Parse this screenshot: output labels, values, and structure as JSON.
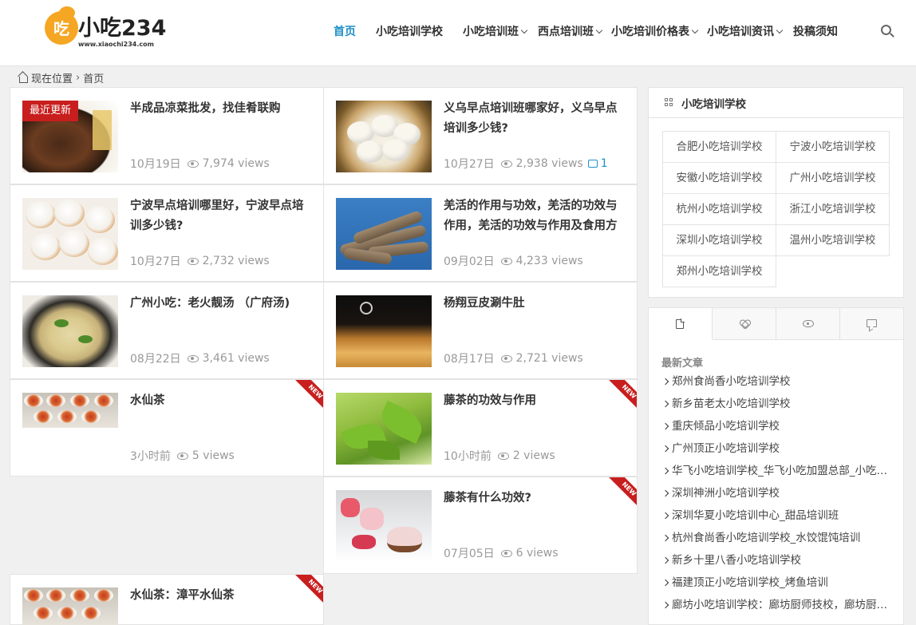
{
  "brand": {
    "name": "小吃234",
    "logo_char": "吃",
    "url_text": "www.xiaochi234.com"
  },
  "nav": {
    "items": [
      {
        "label": "首页",
        "active": true,
        "dropdown": false
      },
      {
        "label": "小吃培训学校",
        "active": false,
        "dropdown": false
      },
      {
        "label": "小吃培训班",
        "active": false,
        "dropdown": true
      },
      {
        "label": "西点培训班",
        "active": false,
        "dropdown": true
      },
      {
        "label": "小吃培训价格表",
        "active": false,
        "dropdown": true
      },
      {
        "label": "小吃培训资讯",
        "active": false,
        "dropdown": true
      },
      {
        "label": "投稿须知",
        "active": false,
        "dropdown": false
      }
    ],
    "search_icon": "search-icon"
  },
  "breadcrumb": {
    "location_label": "现在位置",
    "separator": "›",
    "current": "首页"
  },
  "articles": [
    {
      "title": "半成品凉菜批发，找佳肴联购",
      "date": "10月19日",
      "views": "7,974 views",
      "badge": "最近更新"
    },
    {
      "title": "义乌早点培训班哪家好，义乌早点培训多少钱?",
      "date": "10月27日",
      "views": "2,938 views",
      "comments": "1"
    },
    {
      "title": "宁波早点培训哪里好，宁波早点培训多少钱?",
      "date": "10月27日",
      "views": "2,732 views"
    },
    {
      "title": "羌活的作用与功效，羌活的功效与作用，羌活的功效与作用及食用方法",
      "date": "09月02日",
      "views": "4,233 views"
    },
    {
      "title": "广州小吃：老火靓汤 （广府汤)",
      "date": "08月22日",
      "views": "3,461 views"
    },
    {
      "title": "杨翔豆皮涮牛肚",
      "date": "08月17日",
      "views": "2,721 views"
    },
    {
      "title": "水仙茶",
      "date": "3小时前",
      "views": "5 views",
      "ribbon": "NEW"
    },
    {
      "title": "藤茶的功效与作用",
      "date": "10小时前",
      "views": "2 views",
      "ribbon": "NEW"
    },
    {
      "title": "藤茶有什么功效?",
      "date": "07月05日",
      "views": "6 views",
      "ribbon": "NEW"
    },
    {
      "title": "水仙茶：漳平水仙茶",
      "date": "",
      "views": "",
      "ribbon": "NEW"
    }
  ],
  "sidebar": {
    "schools_title": "小吃培训学校",
    "schools": [
      "合肥小吃培训学校",
      "宁波小吃培训学校",
      "安徽小吃培训学校",
      "广州小吃培训学校",
      "杭州小吃培训学校",
      "浙江小吃培训学校",
      "深圳小吃培训学校",
      "温州小吃培训学校",
      "郑州小吃培训学校"
    ],
    "tabs": [
      "doc-icon",
      "heart-icon",
      "eye-icon",
      "comment-icon"
    ],
    "latest_title": "最新文章",
    "latest": [
      "郑州食尚香小吃培训学校",
      "新乡苗老太小吃培训学校",
      "重庆倾品小吃培训学校",
      "广州顶正小吃培训学校",
      "华飞小吃培训学校_华飞小吃加盟总部_小吃培训",
      "深圳神洲小吃培训学校",
      "深圳华夏小吃培训中心_甜品培训班",
      "杭州食尚香小吃培训学校_水饺馄饨培训",
      "新乡十里八香小吃培训学校",
      "福建顶正小吃培训学校_烤鱼培训",
      "廊坊小吃培训学校：廊坊厨师技校，廊坊厨师培训"
    ]
  }
}
